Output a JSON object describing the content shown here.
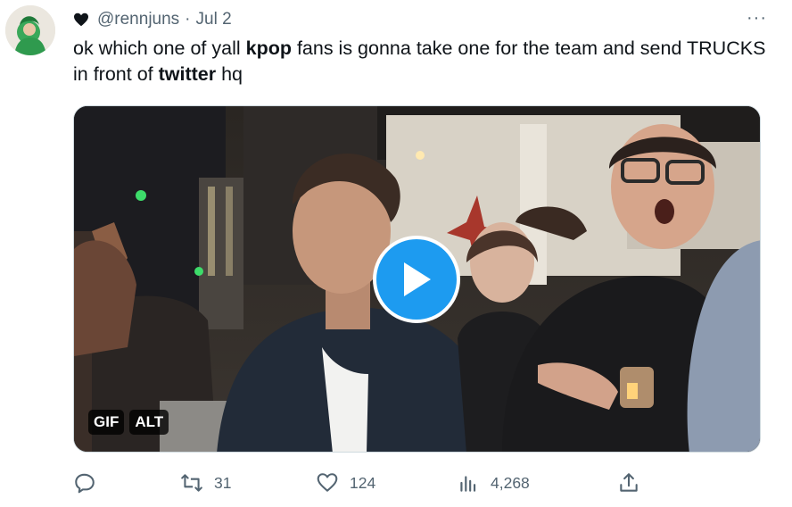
{
  "tweet": {
    "handle": "@rennjuns",
    "separator": "·",
    "date": "Jul 2",
    "more_label": "···",
    "text_parts": [
      {
        "text": "ok which one of yall ",
        "bold": false
      },
      {
        "text": "kpop",
        "bold": true
      },
      {
        "text": " fans is gonna take one for the team and send TRUCKS in front of ",
        "bold": false
      },
      {
        "text": "twitter",
        "bold": true
      },
      {
        "text": " hq",
        "bold": false
      }
    ],
    "media": {
      "badge_gif": "GIF",
      "badge_alt": "ALT",
      "play_icon": "play-icon"
    },
    "actions": {
      "reply_count": "",
      "retweet_count": "31",
      "like_count": "124",
      "views_count": "4,268"
    }
  },
  "colors": {
    "accent": "#1d9bf0",
    "text": "#0f1419",
    "secondary": "#536471"
  }
}
